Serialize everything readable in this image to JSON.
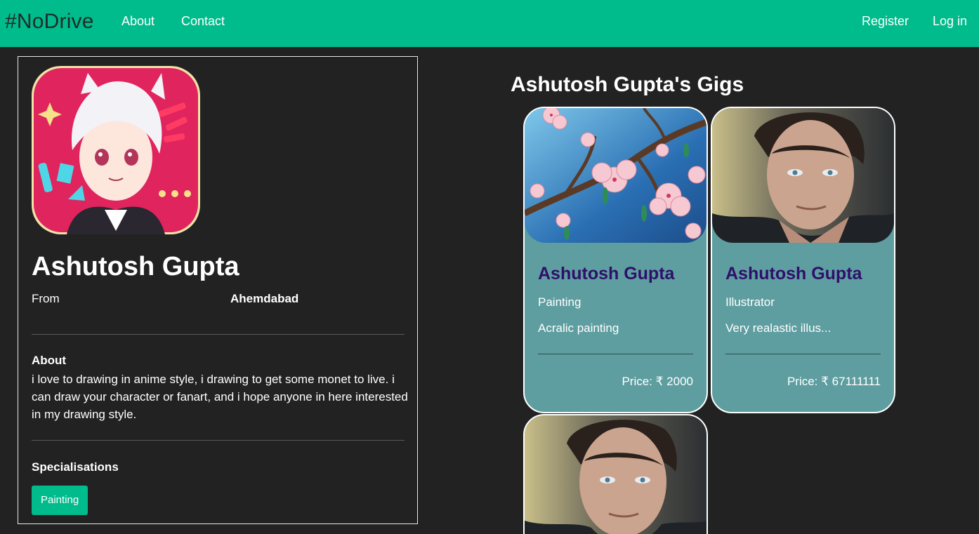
{
  "navbar": {
    "brand": "#NoDrive",
    "links": [
      "About",
      "Contact"
    ],
    "right_links": [
      "Register",
      "Log in"
    ],
    "color": "#00bc8c"
  },
  "profile": {
    "name": "Ashutosh Gupta",
    "from_label": "From",
    "from_value": "Ahemdabad",
    "about_title": "About",
    "about_text": "i love to drawing in anime style, i drawing to get some monet to live. i can draw your character or fanart, and i hope anyone in here interested in my drawing style.",
    "specialisations_title": "Specialisations",
    "specialisations": [
      "Painting"
    ],
    "avatar": "anime-avatar-image"
  },
  "gigs": {
    "title": "Ashutosh Gupta's Gigs",
    "items": [
      {
        "image": "cherry-blossom-painting",
        "name": "Ashutosh Gupta",
        "category": "Painting",
        "description": "Acralic painting",
        "price": "Price: ₹ 2000"
      },
      {
        "image": "man-portrait-photo",
        "name": "Ashutosh Gupta",
        "category": "Illustrator",
        "description": "Very realastic illus...",
        "price": "Price: ₹ 67111111"
      },
      {
        "image": "man-portrait-photo"
      }
    ]
  }
}
